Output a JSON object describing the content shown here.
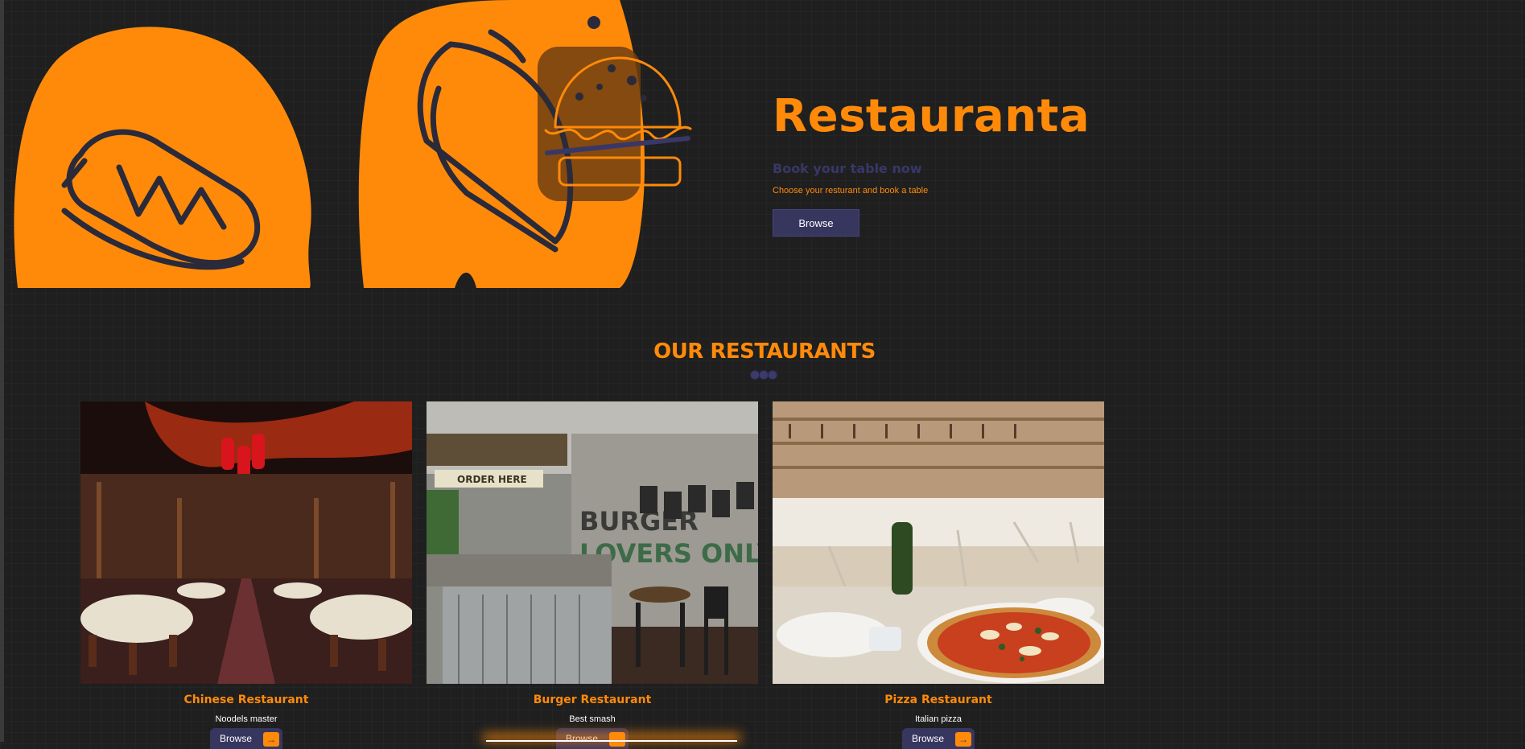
{
  "hero": {
    "title": "Restauranta",
    "subtitle": "Book your table now",
    "description": "Choose your resturant and book a table",
    "browse_label": "Browse"
  },
  "section": {
    "title": "OUR RESTAURANTS"
  },
  "restaurants": [
    {
      "name": "Chinese Restaurant",
      "tagline": "Noodels master",
      "button_label": "Browse"
    },
    {
      "name": "Burger Restaurant",
      "tagline": "Best smash",
      "button_label": "Browse"
    },
    {
      "name": "Pizza Restaurant",
      "tagline": "Italian pizza",
      "button_label": "Browse"
    }
  ],
  "colors": {
    "background": "#1f1f1f",
    "accent": "#ff8a0a",
    "navy": "#37365f",
    "text": "#ffffff"
  },
  "icons": [
    "hotdog-icon",
    "taco-icon",
    "burger-icon",
    "arrow-right-icon"
  ]
}
